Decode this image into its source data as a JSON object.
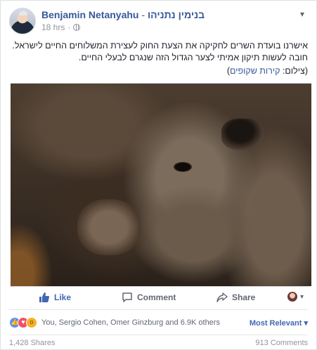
{
  "post": {
    "author": "Benjamin Netanyahu",
    "separator": " - ",
    "author_hebrew": "בנימין נתניהו",
    "time": "18 hrs",
    "menu_icon": "chevron-down-icon",
    "text_main": "אישרנו בועדת השרים לחקיקה את הצעת החוק לעצירת המשלוחים החיים לישראל. חובה לעשות תיקון אמיתי לצער הגדול הזה שנגרם לבעלי החיים.",
    "credit_prefix": "(צילום: ",
    "credit_link": "קירות שקופים",
    "credit_suffix": ")"
  },
  "actions": {
    "like": "Like",
    "comment": "Comment",
    "share": "Share"
  },
  "reactions": {
    "summary": "You, Sergio Cohen, Omer Ginzburg and 6.9K others",
    "sort_label": "Most Relevant",
    "sort_icon": "caret-down-icon"
  },
  "stats": {
    "shares": "1,428 Shares",
    "comments": "913 Comments"
  },
  "colors": {
    "link": "#365899",
    "like_blue": "#4267b2",
    "muted": "#90949c"
  }
}
